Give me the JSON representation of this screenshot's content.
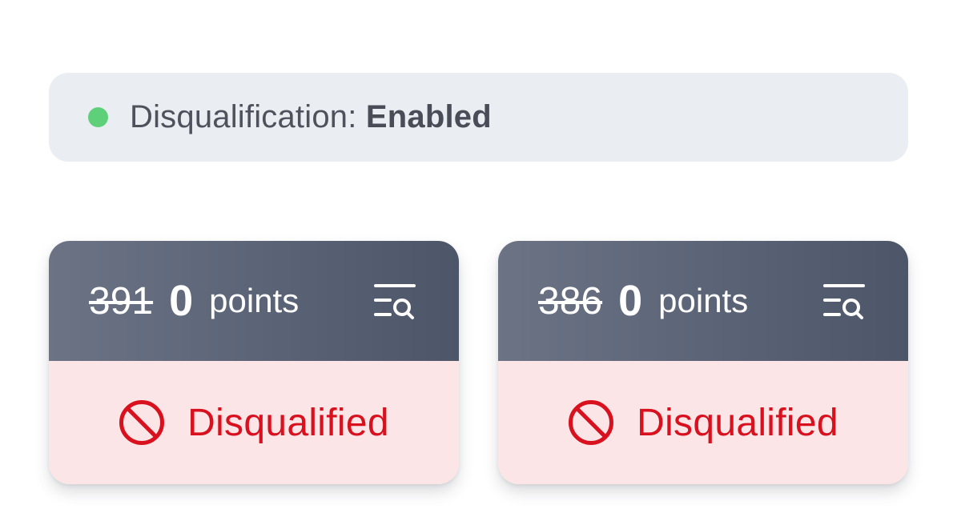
{
  "status": {
    "label": "Disqualification:",
    "value": "Enabled",
    "indicator_color": "#5fd07a",
    "indicator_icon": "green-dot-icon"
  },
  "cards": [
    {
      "original_score": "391",
      "current_score": "0",
      "unit": "points",
      "details_icon": "list-search-icon",
      "status_label": "Disqualified",
      "status_icon": "ban-icon",
      "status_color": "#d9101e"
    },
    {
      "original_score": "386",
      "current_score": "0",
      "unit": "points",
      "details_icon": "list-search-icon",
      "status_label": "Disqualified",
      "status_icon": "ban-icon",
      "status_color": "#d9101e"
    }
  ]
}
